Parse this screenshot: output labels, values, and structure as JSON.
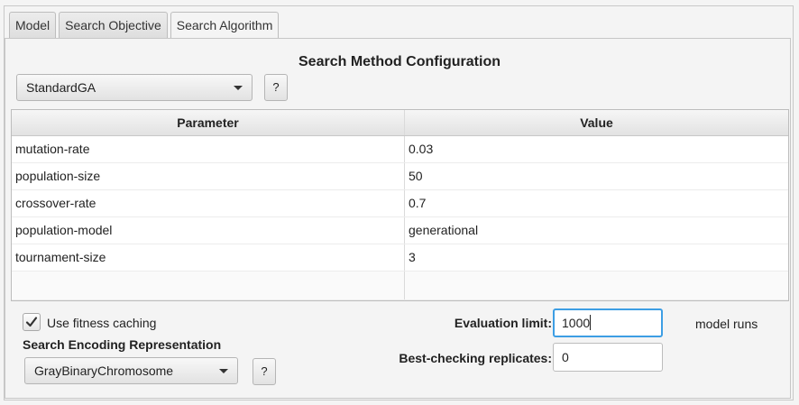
{
  "tabs": [
    {
      "label": "Model"
    },
    {
      "label": "Search Objective"
    },
    {
      "label": "Search Algorithm"
    }
  ],
  "active_tab": "Search Algorithm",
  "config": {
    "title": "Search Method Configuration",
    "method_selected": "StandardGA",
    "help_label": "?"
  },
  "table": {
    "headers": {
      "parameter": "Parameter",
      "value": "Value"
    },
    "rows": [
      {
        "parameter": "mutation-rate",
        "value": "0.03"
      },
      {
        "parameter": "population-size",
        "value": "50"
      },
      {
        "parameter": "crossover-rate",
        "value": "0.7"
      },
      {
        "parameter": "population-model",
        "value": "generational"
      },
      {
        "parameter": "tournament-size",
        "value": "3"
      }
    ]
  },
  "fitness_caching": {
    "label": "Use fitness caching",
    "checked": true
  },
  "encoding": {
    "title": "Search Encoding Representation",
    "selected": "GrayBinaryChromosome",
    "help_label": "?"
  },
  "evaluation": {
    "label": "Evaluation limit:",
    "value": "1000",
    "unit": "model runs"
  },
  "replicates": {
    "label": "Best-checking replicates:",
    "value": "0"
  }
}
